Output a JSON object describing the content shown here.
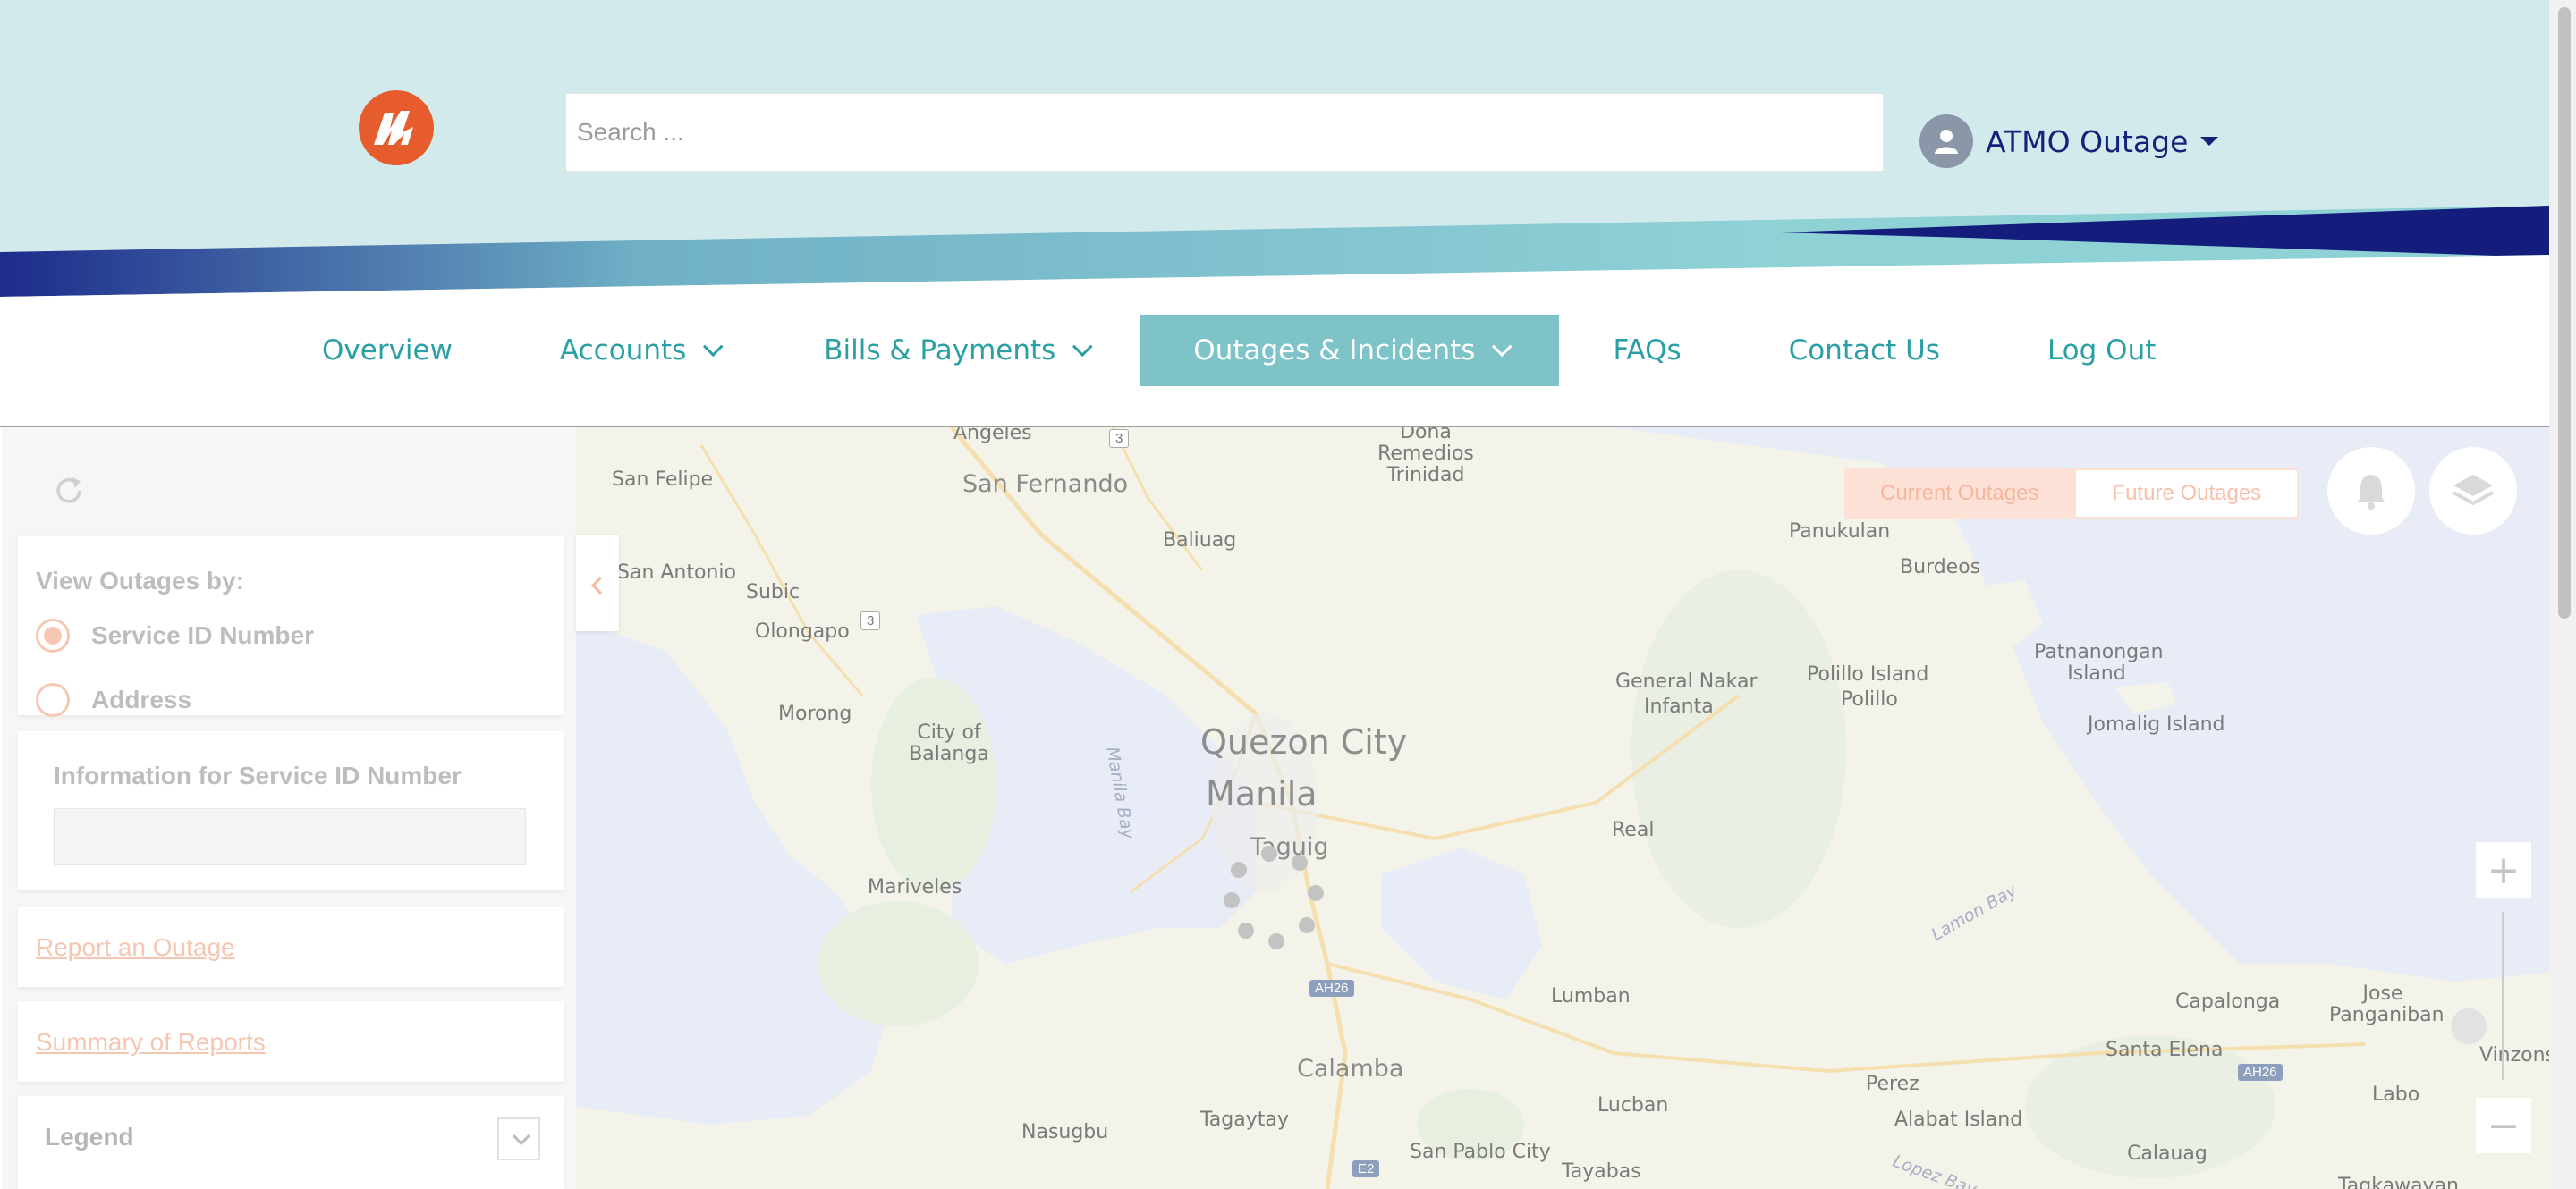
{
  "header": {
    "search_placeholder": "Search ...",
    "user_name": "ATMO Outage",
    "colors": {
      "header_bg": "#d3eaec",
      "brand_navy": "#14237a",
      "logo_orange": "#e65c2c",
      "nav_teal": "#2aa0a4"
    }
  },
  "nav": {
    "items": [
      {
        "label": "Overview"
      },
      {
        "label": "Accounts"
      },
      {
        "label": "Bills & Payments"
      },
      {
        "label": "Outages & Incidents"
      },
      {
        "label": "FAQs"
      },
      {
        "label": "Contact Us"
      },
      {
        "label": "Log Out"
      }
    ],
    "active": "Outages & Incidents"
  },
  "panel": {
    "view_by_label": "View Outages by:",
    "options": [
      {
        "label": "Service ID Number",
        "selected": true
      },
      {
        "label": "Address",
        "selected": false
      }
    ],
    "info_label": "Information for Service ID Number",
    "report_link": "Report an Outage",
    "summary_link": "Summary of Reports",
    "legend_label": "Legend"
  },
  "map": {
    "toggle": {
      "current": "Current Outages",
      "future": "Future Outages"
    },
    "zoom": {
      "in": "+",
      "out": "−"
    },
    "labels": {
      "angeles": "Angeles",
      "san_felipe": "San Felipe",
      "san_fernando": "San Fernando",
      "dona_remedios": "Dona Remedios Trinidad",
      "baliuag": "Baliuag",
      "san_antonio": "San Antonio",
      "subic": "Subic",
      "olongapo": "Olongapo",
      "panukulan": "Panukulan",
      "burdeos": "Burdeos",
      "patnanongan": "Patnanongan Island",
      "polillo_island": "Polillo Island",
      "polillo": "Polillo",
      "jomalig": "Jomalig Island",
      "general_nakar": "General Nakar",
      "infanta": "Infanta",
      "morong": "Morong",
      "city_of_balanga": "City of Balanga",
      "quezon_city": "Quezon City",
      "manila": "Manila",
      "taguig": "Taguig",
      "manila_bay": "Manila Bay",
      "real": "Real",
      "lamon_bay": "Lamon Bay",
      "mariveles": "Mariveles",
      "lumban": "Lumban",
      "calamba": "Calamba",
      "capalonga": "Capalonga",
      "jose_panganiban": "Jose Panganiban",
      "santa_elena": "Santa Elena",
      "vinzons": "Vinzons",
      "perez": "Perez",
      "labo": "Labo",
      "alabat": "Alabat Island",
      "calauag": "Calauag",
      "lucban": "Lucban",
      "tagaytay": "Tagaytay",
      "nasugbu": "Nasugbu",
      "san_pablo": "San Pablo City",
      "tayabas": "Tayabas",
      "lopez_bay": "Lopez Bay",
      "tagkawayan": "Tagkawayan"
    },
    "roads": {
      "r3a": "3",
      "r3b": "3",
      "ah26a": "AH26",
      "ah26b": "AH26",
      "e2": "E2"
    }
  }
}
